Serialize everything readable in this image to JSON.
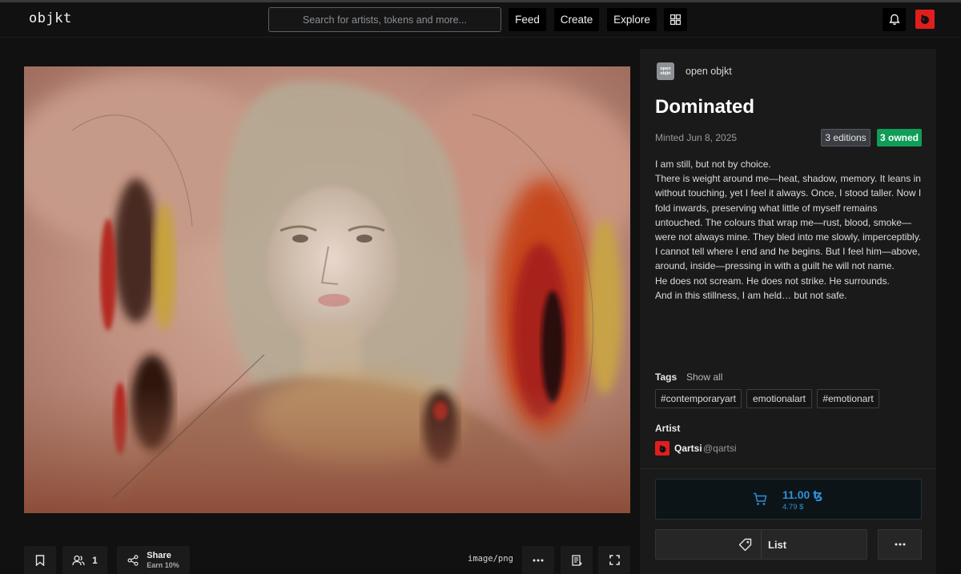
{
  "header": {
    "logo": "objkt",
    "search_placeholder": "Search for artists, tokens and more...",
    "nav": {
      "feed": "Feed",
      "create": "Create",
      "explore": "Explore"
    },
    "icons": [
      "grid-icon",
      "bell-icon",
      "user-avatar"
    ]
  },
  "artwork": {
    "mime_type": "image/png",
    "collectors_count": "1",
    "share_label": "Share",
    "share_sub": "Earn 10%"
  },
  "token": {
    "collection_icon_text": "open objkt",
    "collection_name": "open objkt",
    "title": "Dominated",
    "minted": "Minted Jun 8, 2025",
    "editions_badge": "3 editions",
    "owned_badge": "3 owned",
    "description": [
      "I am still, but not by choice.",
      "There is weight around me—heat, shadow, memory. It leans in without touching, yet I feel it always. Once, I stood taller. Now I fold inwards, preserving what little of myself remains untouched. The colours that wrap me—rust, blood, smoke—were not always mine. They bled into me slowly, imperceptibly.",
      "I cannot tell where I end and he begins. But I feel him—above, around, inside—pressing in with a guilt he will not name.",
      "He does not scream. He does not strike. He surrounds.",
      "And in this stillness, I am held… but not safe."
    ],
    "tags_label": "Tags",
    "show_all": "Show all",
    "tags": [
      "#contemporaryart",
      "emotionalart",
      "#emotionart"
    ],
    "artist_label": "Artist",
    "artist_name": "Qartsi",
    "artist_handle": "@qartsi"
  },
  "market": {
    "price": "11.00 ꜩ",
    "price_usd": "4.79 $",
    "list_label": "List"
  },
  "colors": {
    "background": "#111111",
    "panel": "#1a1a1a",
    "owned_badge": "#0f9d58",
    "price_blue": "#2d8fd4",
    "avatar_red": "#e01e1e"
  }
}
